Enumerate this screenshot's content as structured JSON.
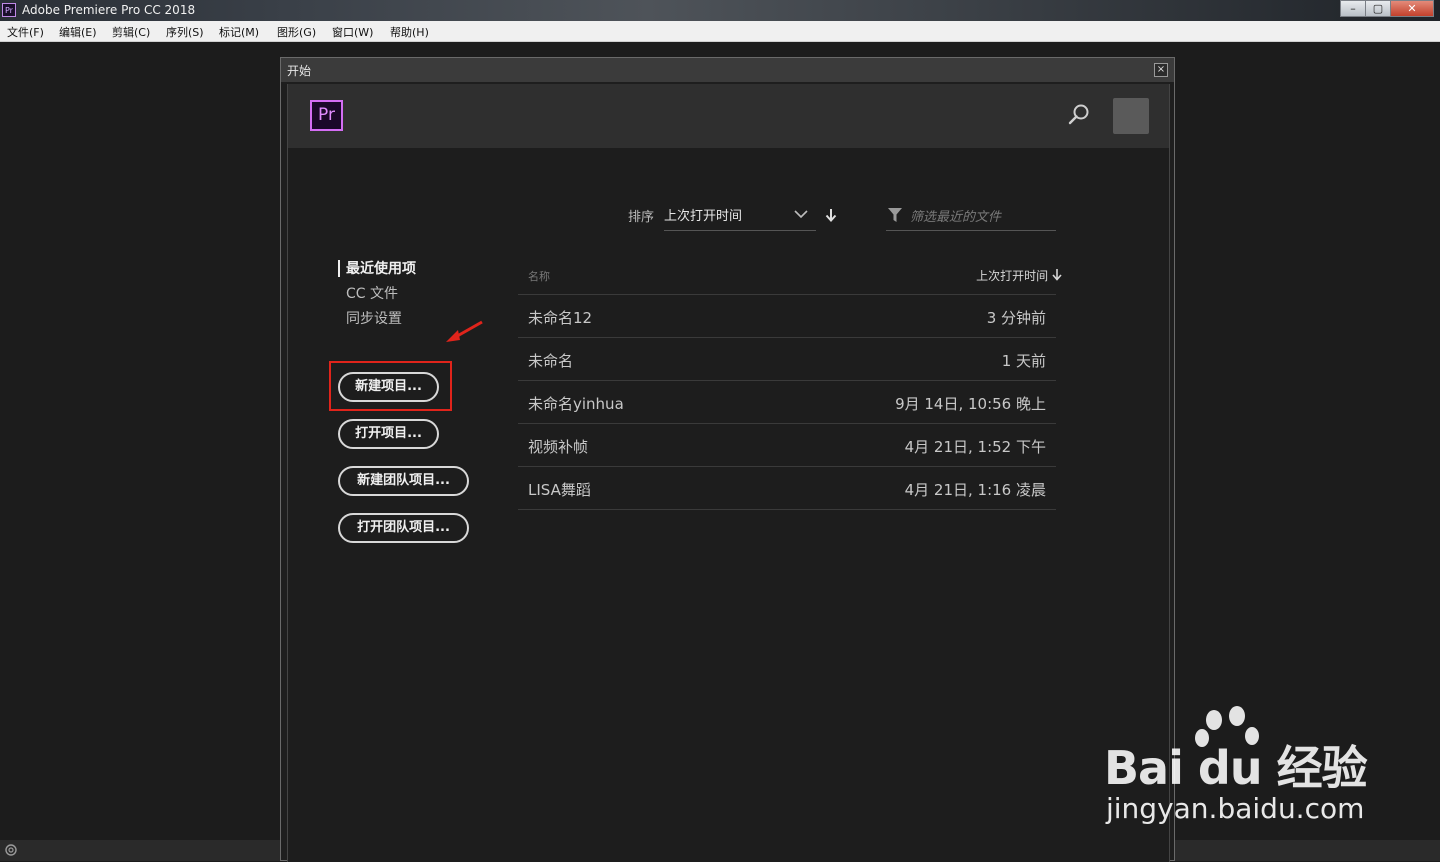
{
  "window": {
    "title": "Adobe Premiere Pro CC 2018",
    "app_badge": "Pr",
    "controls": [
      "–",
      "▢",
      "✕"
    ]
  },
  "menubar": {
    "items": [
      "文件(F)",
      "编辑(E)",
      "剪辑(C)",
      "序列(S)",
      "标记(M)",
      "图形(G)",
      "窗口(W)",
      "帮助(H)"
    ]
  },
  "dialog": {
    "title": "开始",
    "close": "×",
    "logo": "Pr",
    "sort": {
      "label": "排序",
      "value": "上次打开时间"
    },
    "filter": {
      "placeholder": "筛选最近的文件"
    },
    "nav": [
      "最近使用项",
      "CC 文件",
      "同步设置"
    ],
    "buttons": [
      "新建项目...",
      "打开项目...",
      "新建团队项目...",
      "打开团队项目..."
    ],
    "table": {
      "col_name": "名称",
      "col_time": "上次打开时间",
      "rows": [
        {
          "name": "未命名12",
          "time": "3 分钟前"
        },
        {
          "name": "未命名",
          "time": "1 天前"
        },
        {
          "name": "未命名yinhua",
          "time": "9月 14日, 10:56 晚上"
        },
        {
          "name": "视频补帧",
          "time": "4月 21日, 1:52 下午"
        },
        {
          "name": "LISA舞蹈",
          "time": "4月 21日, 1:16 凌晨"
        }
      ]
    }
  },
  "watermark": {
    "brand": "Bai du 经验",
    "url": "jingyan.baidu.com"
  },
  "colors": {
    "highlight": "#e0241b",
    "pr_purple": "#d36df3",
    "panel_bg": "#1d1d1d"
  }
}
